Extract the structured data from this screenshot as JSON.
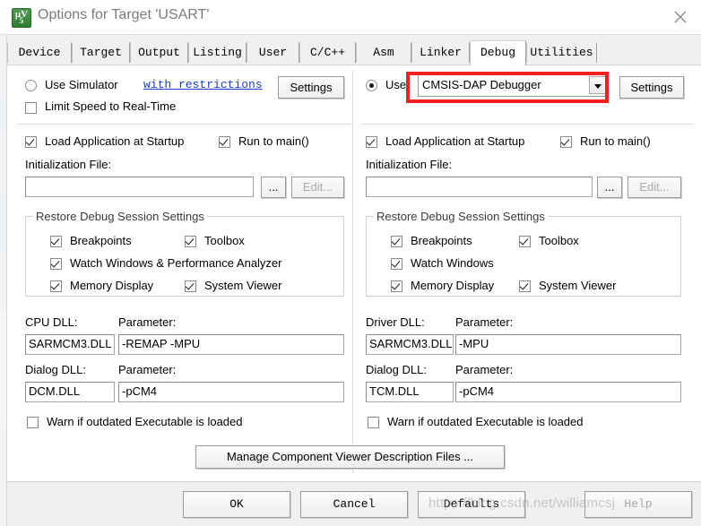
{
  "window": {
    "title": "Options for Target 'USART'",
    "icon": "uvision-logo-icon",
    "close_label": "close-icon"
  },
  "tabs": [
    {
      "label": "Device",
      "selected": false
    },
    {
      "label": "Target",
      "selected": false
    },
    {
      "label": "Output",
      "selected": false
    },
    {
      "label": "Listing",
      "selected": false
    },
    {
      "label": "User",
      "selected": false
    },
    {
      "label": "C/C++",
      "selected": false
    },
    {
      "label": "Asm",
      "selected": false
    },
    {
      "label": "Linker",
      "selected": false
    },
    {
      "label": "Debug",
      "selected": true
    },
    {
      "label": "Utilities",
      "selected": false
    }
  ],
  "left": {
    "use_simulator_label": "Use Simulator",
    "use_simulator_checked": false,
    "restrictions_link": "with restrictions",
    "settings_label": "Settings",
    "limit_speed_label": "Limit Speed to Real-Time",
    "limit_speed_checked": false,
    "load_app_label": "Load Application at Startup",
    "load_app_checked": true,
    "run_to_main_label": "Run to main()",
    "run_to_main_checked": true,
    "init_file_label": "Initialization File:",
    "init_file_value": "",
    "browse_label": "...",
    "edit_label": "Edit...",
    "edit_disabled": true,
    "group_title": "Restore Debug Session Settings",
    "restore": [
      {
        "label": "Breakpoints",
        "checked": true
      },
      {
        "label": "Toolbox",
        "checked": true
      },
      {
        "label": "Watch Windows & Performance Analyzer",
        "checked": true
      },
      {
        "label": "Memory Display",
        "checked": true
      },
      {
        "label": "System Viewer",
        "checked": true
      }
    ],
    "cpu_dll_label": "CPU DLL:",
    "cpu_dll_value": "SARMCM3.DLL",
    "cpu_param_label": "Parameter:",
    "cpu_param_value": "-REMAP -MPU",
    "dialog_dll_label": "Dialog DLL:",
    "dialog_dll_value": "DCM.DLL",
    "dialog_param_label": "Parameter:",
    "dialog_param_value": "-pCM4",
    "warn_label": "Warn if outdated Executable is loaded",
    "warn_checked": false
  },
  "right": {
    "use_label": "Use:",
    "use_checked": true,
    "debugger_value": "CMSIS-DAP Debugger",
    "settings_label": "Settings",
    "load_app_label": "Load Application at Startup",
    "load_app_checked": true,
    "run_to_main_label": "Run to main()",
    "run_to_main_checked": true,
    "init_file_label": "Initialization File:",
    "init_file_value": "",
    "browse_label": "...",
    "edit_label": "Edit...",
    "edit_disabled": true,
    "group_title": "Restore Debug Session Settings",
    "restore": [
      {
        "label": "Breakpoints",
        "checked": true
      },
      {
        "label": "Toolbox",
        "checked": true
      },
      {
        "label": "Watch Windows",
        "checked": true
      },
      {
        "label": "Memory Display",
        "checked": true
      },
      {
        "label": "System Viewer",
        "checked": true
      }
    ],
    "driver_dll_label": "Driver DLL:",
    "driver_dll_value": "SARMCM3.DLL",
    "driver_param_label": "Parameter:",
    "driver_param_value": "-MPU",
    "dialog_dll_label": "Dialog DLL:",
    "dialog_dll_value": "TCM.DLL",
    "dialog_param_label": "Parameter:",
    "dialog_param_value": "-pCM4",
    "warn_label": "Warn if outdated Executable is loaded",
    "warn_checked": false
  },
  "manage_button": "Manage Component Viewer Description Files ...",
  "footer": {
    "ok": "OK",
    "cancel": "Cancel",
    "defaults": "Defaults",
    "help": "Help"
  },
  "annotation": {
    "highlight_color": "#f42020",
    "target": "debugger-select"
  },
  "watermark": "https://blog.csdn.net/williamcsj"
}
